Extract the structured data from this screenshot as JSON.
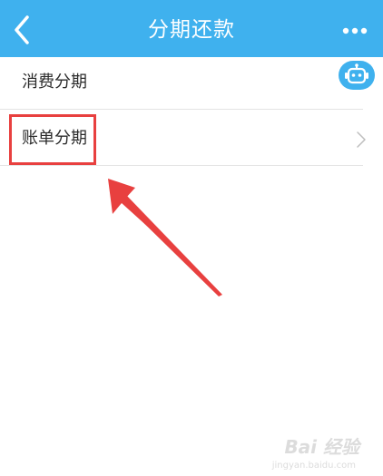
{
  "nav": {
    "title": "分期还款",
    "back_icon": "chevron-left-icon",
    "more_icon": "more-dots-icon"
  },
  "list": {
    "items": [
      {
        "label": "消费分期"
      },
      {
        "label": "账单分期",
        "icon": "chevron-right-icon"
      }
    ]
  },
  "floating": {
    "icon": "robot-icon"
  },
  "watermark": {
    "text": "Bai 经验",
    "sub": "jingyan.baidu.com"
  },
  "colors": {
    "nav_bg": "#3fb1ee",
    "highlight": "#e8403f",
    "text": "#2b2b2b",
    "divider": "#e4e4e4"
  }
}
